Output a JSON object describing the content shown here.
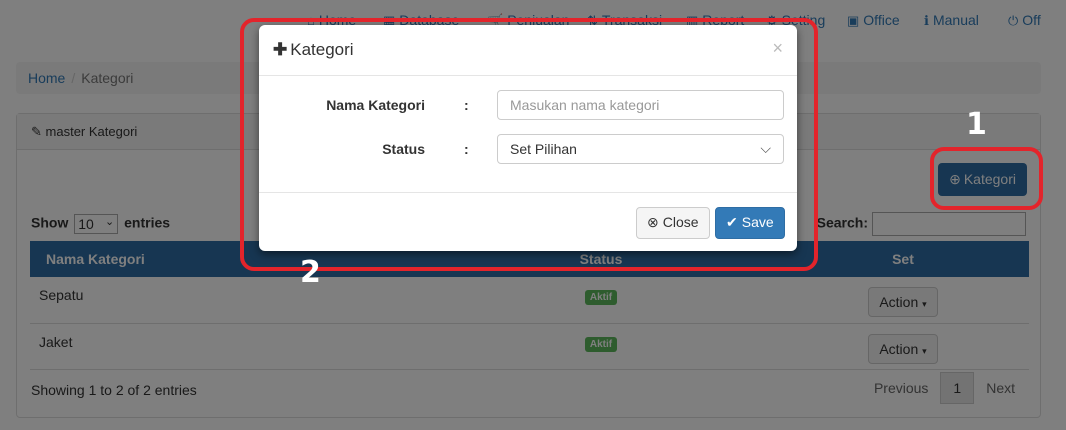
{
  "topnav": [
    {
      "icon": "home-icon",
      "glyph": "⌂",
      "label": "Home"
    },
    {
      "icon": "database-icon",
      "glyph": "▦",
      "label": "Database"
    },
    {
      "icon": "cart-icon",
      "glyph": "🛒",
      "label": "Penjualan"
    },
    {
      "icon": "transfer-icon",
      "glyph": "⇅",
      "label": "Transaksi"
    },
    {
      "icon": "chart-icon",
      "glyph": "▥",
      "label": "Report"
    },
    {
      "icon": "gear-icon",
      "glyph": "⚙",
      "label": "Setting"
    },
    {
      "icon": "briefcase-icon",
      "glyph": "▣",
      "label": "Office"
    },
    {
      "icon": "info-icon",
      "glyph": "ℹ",
      "label": "Manual"
    },
    {
      "icon": "power-icon",
      "glyph": "⏻",
      "label": "Off"
    }
  ],
  "breadcrumb": {
    "home": "Home",
    "current": "Kategori"
  },
  "panel": {
    "title": "master Kategori",
    "add_button": "Kategori"
  },
  "table": {
    "show_label": "Show",
    "show_value": "10",
    "entries_label": "entries",
    "search_label": "Search:",
    "headers": [
      "Nama Kategori",
      "Status",
      "Set"
    ],
    "rows": [
      {
        "name": "Sepatu",
        "status": "Aktif",
        "action": "Action"
      },
      {
        "name": "Jaket",
        "status": "Aktif",
        "action": "Action"
      }
    ],
    "info": "Showing 1 to 2 of 2 entries",
    "pager": {
      "prev": "Previous",
      "page": "1",
      "next": "Next"
    }
  },
  "modal": {
    "title": "Kategori",
    "close_x": "×",
    "fields": {
      "name_label": "Nama Kategori",
      "name_placeholder": "Masukan nama kategori",
      "status_label": "Status",
      "status_value": "Set Pilihan",
      "colon": ":"
    },
    "close_button": "Close",
    "save_button": "Save"
  },
  "annotations": {
    "one": "1",
    "two": "2",
    "color": "#e3242b"
  },
  "colors": {
    "primary": "#337ab7",
    "header": "#2e6da4",
    "success": "#5cb85c"
  }
}
